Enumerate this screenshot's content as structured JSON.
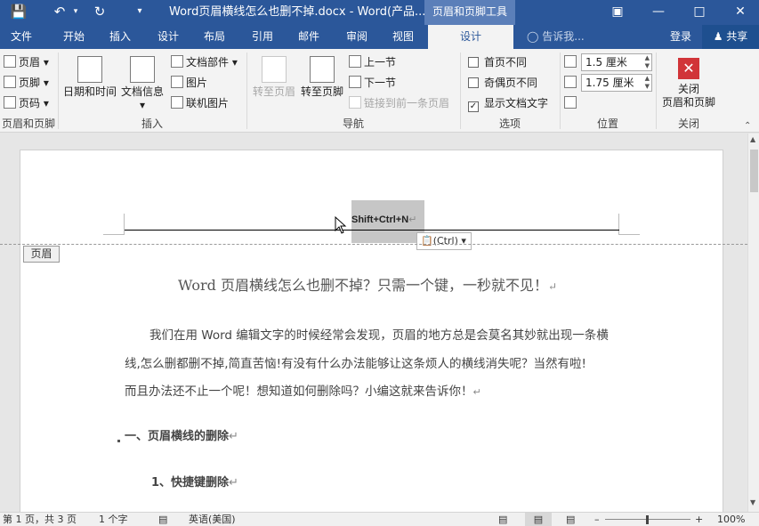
{
  "titlebar": {
    "title": "Word页眉横线怎么也删不掉.docx - Word(产品...",
    "context_tools": "页眉和页脚工具",
    "save_icon": "save-icon",
    "undo_icon": "undo-icon",
    "redo_icon": "redo-icon",
    "customize_icon": "customize-qat-icon"
  },
  "tabs": [
    "文件",
    "开始",
    "插入",
    "设计",
    "布局",
    "引用",
    "邮件",
    "审阅",
    "视图"
  ],
  "active_tab": "设计",
  "tell_me": "告诉我...",
  "login": "登录",
  "share": "共享",
  "ribbon": {
    "hf_group": {
      "items": [
        "页眉",
        "页脚",
        "页码"
      ],
      "label": "页眉和页脚"
    },
    "insert_group": {
      "datetime": "日期和时间",
      "docinfo": "文档信息",
      "docparts": "文档部件",
      "picture": "图片",
      "online_picture": "联机图片",
      "label": "插入"
    },
    "nav_group": {
      "goto_header": "转至页眉",
      "goto_footer": "转至页脚",
      "prev": "上一节",
      "next": "下一节",
      "link_prev": "链接到前一条页眉",
      "label": "导航"
    },
    "options_group": {
      "first_page": "首页不同",
      "odd_even": "奇偶页不同",
      "show_text": "显示文档文字",
      "label": "选项"
    },
    "position_group": {
      "header_pos": "1.5 厘米",
      "footer_pos": "1.75 厘米",
      "label": "位置"
    },
    "close_group": {
      "button_line1": "关闭",
      "button_line2": "页眉和页脚",
      "label": "关闭"
    }
  },
  "document": {
    "header_selection": "Shift+Ctrl+N",
    "header_tag": "页眉",
    "paste_options": "(Ctrl)",
    "title": "Word 页眉横线怎么也删不掉？只需一个键，一秒就不见！",
    "para_lines": [
      "我们在用 Word 编辑文字的时候经常会发现，页眉的地方总是会莫名其妙就出现一条横",
      "线,怎么删都删不掉,简直苦恼!有没有什么办法能够让这条烦人的横线消失呢？当然有啦!",
      "而且办法还不止一个呢！想知道如何删除吗？小编这就来告诉你！"
    ],
    "heading1": "一、页眉横线的删除",
    "heading2": "1、快捷键删除"
  },
  "statusbar": {
    "page": "第 1 页，共 3 页",
    "words": "1 个字",
    "language": "英语(美国)",
    "zoom": "100%"
  }
}
